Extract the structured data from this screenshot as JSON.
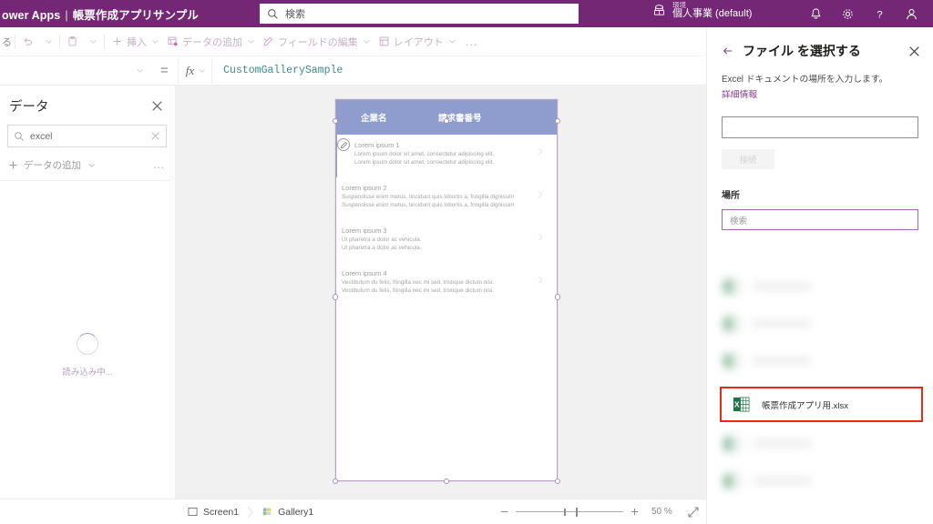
{
  "header": {
    "brand": "ower Apps",
    "divider": "|",
    "app_name": "帳票作成アプリサンプル",
    "search_placeholder": "検索",
    "search_icon": "search-icon",
    "environment_label": "環境",
    "environment_name": "個人事業 (default)",
    "environment_icon": "environment-icon",
    "icons": [
      {
        "name": "notification-bell-icon",
        "glyph": "bell"
      },
      {
        "name": "settings-gear-icon",
        "glyph": "gear"
      },
      {
        "name": "help-question-icon",
        "glyph": "question"
      },
      {
        "name": "user-account-icon",
        "glyph": "person"
      }
    ]
  },
  "toolbar": {
    "partial_label": "る",
    "undo_icon": "undo-icon",
    "paste_icon": "paste-icon",
    "items": [
      {
        "label": "挿入",
        "icon": "plus-icon",
        "has_chevron": true
      },
      {
        "label": "データの追加",
        "icon": "add-data-icon",
        "has_chevron": true
      },
      {
        "label": "フィールドの編集",
        "icon": "edit-fields-icon",
        "has_chevron": true
      },
      {
        "label": "レイアウト",
        "icon": "layout-icon",
        "has_chevron": true
      }
    ],
    "overflow": "..."
  },
  "formula_bar": {
    "property_value": "",
    "equals": "=",
    "fx_label": "fx",
    "formula": "CustomGallerySample"
  },
  "data_pane": {
    "title": "データ",
    "close_icon": "close-icon",
    "search_value": "excel",
    "search_icon": "search-icon",
    "clear_icon": "clear-icon",
    "add_data_label": "データの追加",
    "add_icon": "plus-icon",
    "more_label": "...",
    "loading_text": "読み込み中..."
  },
  "canvas": {
    "gallery_header": {
      "col1": "企業名",
      "col2": "請求書番号"
    },
    "items": [
      {
        "title": "Lorem ipsum 1",
        "line1": "Lorem ipsum dolor sit amet, consectetur adipiscing elit.",
        "line2": "Lorem ipsum dolor sit amet, consectetur adipiscing elit.",
        "selected": true
      },
      {
        "title": "Lorem ipsum 2",
        "line1": "Suspendisse enim metus, tincidunt quis lobortis a, fringilla dignissim",
        "line2": "Suspendisse enim metus, tincidunt quis lobortis a, fringilla dignissim",
        "selected": false
      },
      {
        "title": "Lorem ipsum 3",
        "line1": "Ut pharetra a dolor ac vehicula.",
        "line2": "Ut pharetra a dolor ac vehicula.",
        "selected": false
      },
      {
        "title": "Lorem ipsum 4",
        "line1": "Vestibulum du felis, fringilla nec mi sed, tristique dictum nisi.",
        "line2": "Vestibulum du felis, fringilla nec mi sed, tristique dictum nisi.",
        "selected": false
      }
    ]
  },
  "right_panel": {
    "back_icon": "back-arrow-icon",
    "title": "ファイル を選択する",
    "close_icon": "close-icon",
    "description": "Excel ドキュメントの場所を入力します。",
    "learn_more": "詳細情報",
    "url_input_value": "",
    "connect_button": "接続",
    "location_label": "場所",
    "location_search_placeholder": "検索",
    "highlighted_file": {
      "name": "帳票作成アプリ用.xlsx",
      "icon": "excel-file-icon",
      "highlight_color": "#ee2816"
    }
  },
  "status_bar": {
    "breadcrumb": [
      {
        "label": "Screen1",
        "icon": "screen-icon"
      },
      {
        "label": "Gallery1",
        "icon": "gallery-icon"
      }
    ],
    "zoom_minus_icon": "minus-icon",
    "zoom_plus_icon": "plus-icon",
    "zoom_level": "50 %",
    "expand_icon": "expand-icon"
  },
  "colors": {
    "brand_purple": "#742774",
    "gallery_header_blue": "#8f9dce",
    "highlight_red": "#ee2816",
    "excel_green": "#217346",
    "link_purple": "#8a3f8f"
  }
}
